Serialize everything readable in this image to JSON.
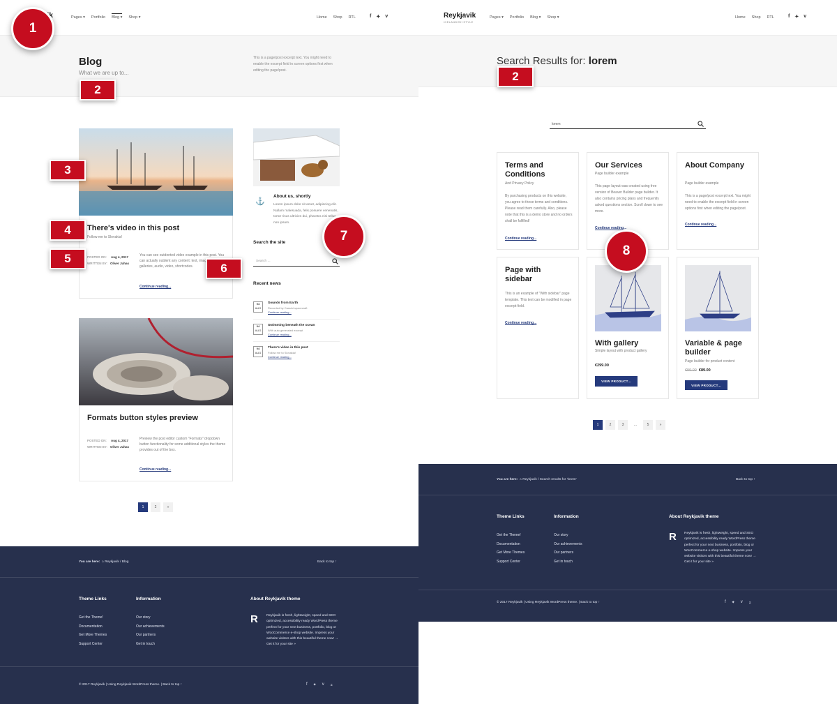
{
  "left": {
    "header": {
      "logo": "vik",
      "nav": [
        "Pages ▾",
        "Portfolio",
        "Blog ▾",
        "Shop ▾"
      ],
      "right_nav": [
        "Home",
        "Shop",
        "RTL"
      ],
      "social": [
        "f",
        "♥",
        "v"
      ]
    },
    "title": "Blog",
    "subtitle": "What we are up to...",
    "excerpt": "This is a page/post excerpt text. You might need to enable the excerpt field in screen options first when editing the page/post.",
    "post1": {
      "title": "There's video in this post",
      "subtitle": "Follow me to Slovakia!",
      "posted_on_label": "POSTED ON:",
      "date": "Aug 4, 2017",
      "written_by_label": "WRITTEN BY:",
      "author": "Oliver Juhas",
      "text": "You can see outdented video example in this post. You can actually outdent any content: text, images, galleries, audio, video, shortcodes.",
      "more": "Continue reading..."
    },
    "post2": {
      "title": "Formats button styles preview",
      "posted_on_label": "POSTED ON:",
      "date": "Aug 4, 2017",
      "written_by_label": "WRITTEN BY:",
      "author": "Oliver Juhas",
      "text": "Preview the post editor custom \"Formats\" dropdown button functionality for some additional styles the theme provides out of the box.",
      "more": "Continue reading..."
    },
    "sidebar": {
      "about_title": "About us, shortly",
      "about_text": "Lorem ipsum dolor sit amet, adipiscing elit. Nullam malesuada, felis posuere venenatis, tortor risus ultricies dui, pharetra nisi tellus non ipsum.",
      "search_title": "Search the site",
      "search_placeholder": "Search ...",
      "recent_title": "Recent news",
      "news": [
        {
          "day": "04",
          "mon": "AUG",
          "title": "Sounds from Earth",
          "sub": "Recorded by Cassini spacecraft",
          "more": "Continue reading..."
        },
        {
          "day": "04",
          "mon": "AUG",
          "title": "Swimming beneath the ocean",
          "sub": "With auto generated excerpt",
          "more": "Continue reading..."
        },
        {
          "day": "04",
          "mon": "AUG",
          "title": "There's video in this post",
          "sub": "Follow me to Slovakia!",
          "more": "Continue reading..."
        }
      ]
    },
    "pagination": [
      "1",
      "2",
      "»"
    ],
    "footer": {
      "you_are_here": "You are here:",
      "crumbs": [
        "Reykjavik",
        "/",
        "Blog"
      ],
      "back_to_top": "Back to top ↑",
      "theme_links_title": "Theme Links",
      "theme_links": [
        "Get the Theme!",
        "Documentation",
        "Get More Themes",
        "Support Center"
      ],
      "info_title": "Information",
      "info_links": [
        "Our story",
        "Our achievements",
        "Our partners",
        "Get in touch"
      ],
      "about_title": "About Reykjavik theme",
      "about_text": "Reykjavik is fresh, lightweight, speed and SEO optimized, accessibility ready WordPress theme perfect for your next business, portfolio, blog or WooCommerce e-shop website. Impress your website visitors with this beautiful theme now! → Get it for your site »",
      "copyright": "© 2017 Reykjavik | Using Reykjavik WordPress theme. | Back to top ↑"
    }
  },
  "right": {
    "header": {
      "logo": "Reykjavik",
      "tagline": "ICELANDISH STYLE",
      "nav": [
        "Pages ▾",
        "Portfolio",
        "Blog ▾",
        "Shop ▾"
      ],
      "right_nav": [
        "Home",
        "Shop",
        "RTL"
      ],
      "social": [
        "f",
        "♥",
        "v"
      ]
    },
    "title_prefix": "Search Results for:",
    "title_query": "lorem",
    "search_value": "lorem",
    "cards": [
      {
        "title": "Terms and Conditions",
        "sub": "And Privacy Policy",
        "text": "By purchasing products on this website, you agree to these terms and conditions. Please read them carefully. Also, please note that this is a demo store and no orders shall be fulfilled!",
        "more": "Continue reading..."
      },
      {
        "title": "Our Services",
        "sub": "Page builder example",
        "text": "This page layout was created using free version of Beaver Builder page builder. It also contains pricing plans and frequently asked questions section. Scroll down to see more.",
        "more": "Continue reading..."
      },
      {
        "title": "About Company",
        "sub": "Page builder example",
        "text": "This is a page/post excerpt text. You might need to enable the excerpt field in screen options first when editing the page/post.",
        "more": "Continue reading..."
      },
      {
        "title": "Page with sidebar",
        "text": "This is an example of \"With sidebar\" page template. This text can be modified in page excerpt field.",
        "more": "Continue reading..."
      },
      {
        "title": "With gallery",
        "sub": "Simple layout with product gallery",
        "price": "€299.00",
        "button": "VIEW PRODUCT..."
      },
      {
        "title": "Variable & page builder",
        "sub": "Page builder for product content",
        "old_price": "€99.00",
        "price": "€89.00",
        "button": "VIEW PRODUCT..."
      }
    ],
    "pagination": [
      "1",
      "2",
      "3",
      "...",
      "5",
      "»"
    ],
    "footer": {
      "you_are_here": "You are here:",
      "crumbs": [
        "Reykjavik",
        "/",
        "Search results for 'lorem'"
      ],
      "back_to_top": "Back to top ↑",
      "theme_links_title": "Theme Links",
      "theme_links": [
        "Get the Theme!",
        "Documentation",
        "Get More Themes",
        "Support Center"
      ],
      "info_title": "Information",
      "info_links": [
        "Our story",
        "Our achievements",
        "Our partners",
        "Get in touch"
      ],
      "about_title": "About Reykjavik theme",
      "about_text": "Reykjavik is fresh, lightweight, speed and SEO optimized, accessibility ready WordPress theme perfect for your next business, portfolio, blog or WooCommerce e-shop website. Impress your website visitors with this beautiful theme now! → Get it for your site »",
      "copyright": "© 2017 Reykjavik | Using Reykjavik WordPress theme. | Back to top ↑"
    }
  },
  "badges": [
    "1",
    "2",
    "3",
    "4",
    "5",
    "6",
    "7",
    "2",
    "8"
  ]
}
